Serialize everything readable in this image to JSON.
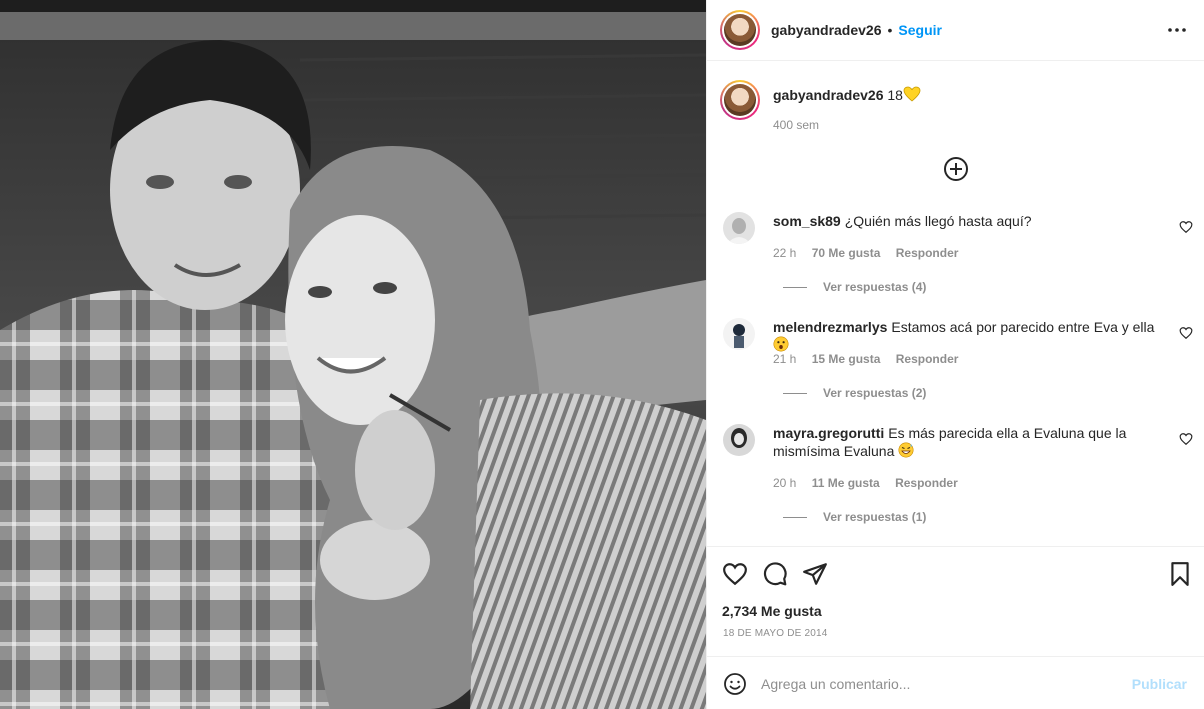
{
  "header": {
    "username": "gabyandradev26",
    "separator": "•",
    "follow_label": "Seguir",
    "more_icon": "more-horizontal-icon"
  },
  "caption": {
    "username": "gabyandradev26",
    "text": "18",
    "emoji": "yellow-heart",
    "time": "400 sem"
  },
  "load_more_icon": "plus-circle-icon",
  "comments": [
    {
      "username": "som_sk89",
      "text": "¿Quién más llegó hasta aquí?",
      "time": "22 h",
      "likes": "70 Me gusta",
      "reply_label": "Responder",
      "view_replies": "Ver respuestas (4)"
    },
    {
      "username": "melendrezmarlys",
      "text": "Estamos acá por parecido entre Eva y ella",
      "emoji": "astonished-face",
      "time": "21 h",
      "likes": "15 Me gusta",
      "reply_label": "Responder",
      "view_replies": "Ver respuestas (2)"
    },
    {
      "username": "mayra.gregorutti",
      "text": "Es más parecida ella a Evaluna que la mismísima Evaluna",
      "emoji": "grinning-sweat-face",
      "time": "20 h",
      "likes": "11 Me gusta",
      "reply_label": "Responder",
      "view_replies": "Ver respuestas (1)"
    }
  ],
  "actions": {
    "icons": [
      "heart-icon",
      "comment-icon",
      "share-icon",
      "bookmark-icon"
    ],
    "likes_total": "2,734 Me gusta",
    "date": "18 DE MAYO DE 2014"
  },
  "add_comment": {
    "placeholder": "Agrega un comentario...",
    "publish_label": "Publicar"
  },
  "colors": {
    "link_blue": "#0095f6",
    "publish_disabled": "#b2dffc",
    "muted_text": "#8e8e8e",
    "border": "#efefef"
  }
}
